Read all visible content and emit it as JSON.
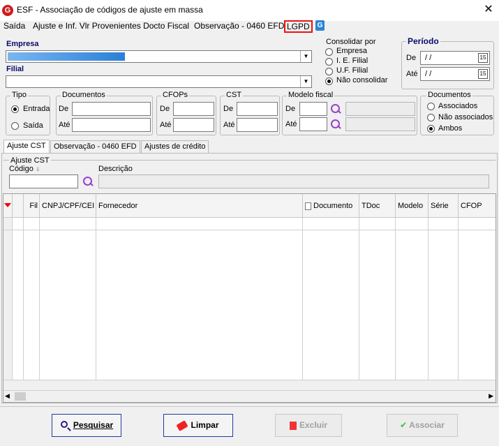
{
  "window": {
    "title": "ESF - Associação de códigos de ajuste em massa",
    "logo": "G"
  },
  "menu": {
    "saida": "Saída",
    "ajuste": "Ajuste e Inf. Vlr Provenientes Docto Fiscal",
    "observacao": "Observação - 0460 EFD",
    "lgpd": "LGPD",
    "g_icon": "G"
  },
  "empresa": {
    "label": "Empresa"
  },
  "filial": {
    "label": "Filial"
  },
  "consolidar": {
    "title": "Consolidar por",
    "options": [
      "Empresa",
      "I. E. Filial",
      "U.F. Filial",
      "Não consolidar"
    ],
    "selected": "Não consolidar"
  },
  "periodo": {
    "title": "Período",
    "de_label": "De",
    "ate_label": "Até",
    "de_value": "/ /",
    "ate_value": "/ /",
    "cal": "15"
  },
  "tipo": {
    "title": "Tipo",
    "options": [
      "Entrada",
      "Saída"
    ],
    "selected": "Entrada"
  },
  "documentos_range": {
    "title": "Documentos",
    "de": "De",
    "ate": "Até"
  },
  "cfops": {
    "title": "CFOPs",
    "de": "De",
    "ate": "Até"
  },
  "cst": {
    "title": "CST",
    "de": "De",
    "ate": "Até"
  },
  "modelo_fiscal": {
    "title": "Modelo fiscal",
    "de": "De",
    "ate": "Até"
  },
  "documentos_filter": {
    "title": "Documentos",
    "options": [
      "Associados",
      "Não associados",
      "Ambos"
    ],
    "selected": "Ambos"
  },
  "tabs": [
    "Ajuste CST",
    "Observação - 0460 EFD",
    "Ajustes de crédito"
  ],
  "ajuste_cst": {
    "title": "Ajuste CST",
    "codigo_label": "Código",
    "descricao_label": "Descrição"
  },
  "grid": {
    "columns": [
      "Fil",
      "CNPJ/CPF/CEI",
      "Fornecedor",
      "Documento",
      "TDoc",
      "Modelo",
      "Série",
      "CFOP"
    ]
  },
  "buttons": {
    "pesquisar": "Pesquisar",
    "limpar": "Limpar",
    "excluir": "Excluir",
    "associar": "Associar"
  },
  "colors": {
    "accent": "#1a3fa0",
    "lgpd_border": "#e11111",
    "search_icon": "#9b3fd0"
  }
}
